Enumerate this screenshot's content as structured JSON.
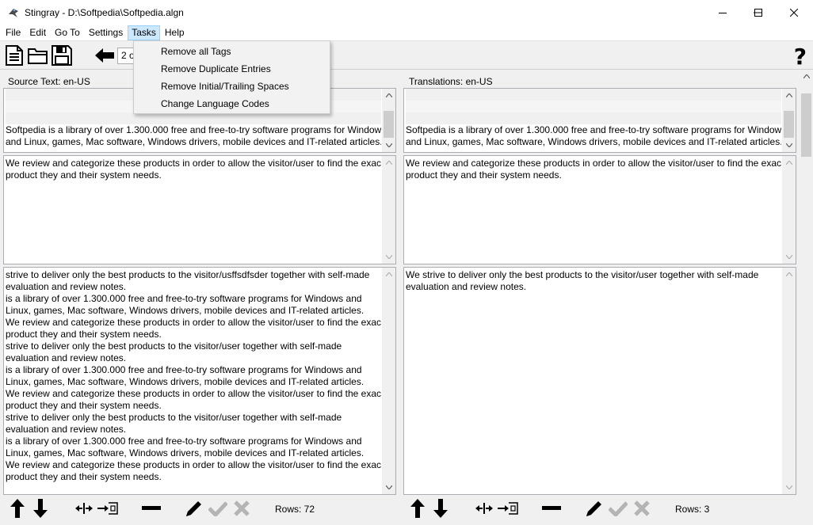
{
  "window": {
    "title": "Stingray - D:\\Softpedia\\Softpedia.algn"
  },
  "menu": {
    "items": [
      "File",
      "Edit",
      "Go To",
      "Settings",
      "Tasks",
      "Help"
    ],
    "active": "Tasks"
  },
  "tasks_menu": {
    "items": [
      "Remove all Tags",
      "Remove Duplicate Entries",
      "Remove Initial/Trailing Spaces",
      "Change Language Codes"
    ]
  },
  "toolbar": {
    "position_value": "2 o",
    "help_label": "?"
  },
  "source": {
    "header": "Source Text: en-US",
    "previous_lines": [
      "",
      "",
      "",
      "Softpedia is a library of over 1.300.000 free and free-to-try software programs for Windows",
      "and Linux, games, Mac software, Windows drivers, mobile devices and IT-related articles."
    ],
    "current_lines": [
      "We review and categorize these products in order to allow the visitor/user to find the exact",
      "product they and their system needs."
    ],
    "next_lines": [
      "strive to deliver only the best products to the visitor/usffsdfsder together with self-made",
      "evaluation and review notes.",
      "is a library of over 1.300.000 free and free-to-try software programs for Windows and",
      "Linux, games, Mac software, Windows drivers, mobile devices and IT-related articles.",
      "We review and categorize these products in order to allow the visitor/user to find the exact",
      "product they and their system needs.",
      "strive to deliver only the best products to the visitor/user together with self-made",
      "evaluation and review notes.",
      "is a library of over 1.300.000 free and free-to-try software programs for Windows and",
      "Linux, games, Mac software, Windows drivers, mobile devices and IT-related articles.",
      "We review and categorize these products in order to allow the visitor/user to find the exact",
      "product they and their system needs.",
      "strive to deliver only the best products to the visitor/user together with self-made",
      "evaluation and review notes.",
      "is a library of over 1.300.000 free and free-to-try software programs for Windows and",
      "Linux, games, Mac software, Windows drivers, mobile devices and IT-related articles.",
      "We review and categorize these products in order to allow the visitor/user to find the exact",
      "product they and their system needs."
    ],
    "rows_label": "Rows: 72"
  },
  "translation": {
    "header": "Translations: en-US",
    "previous_lines": [
      "",
      "",
      "",
      "Softpedia is a library of over 1.300.000 free and free-to-try software programs for Windows",
      "and Linux, games, Mac software, Windows drivers, mobile devices and IT-related articles."
    ],
    "current_lines": [
      "We review and categorize these products in order to allow the visitor/user to find the exact",
      "product they and their system needs."
    ],
    "next_lines": [
      "We strive to deliver only the best products to the visitor/user together with self-made",
      "evaluation and review notes."
    ],
    "rows_label": "Rows: 3"
  },
  "colors": {
    "menu_highlight": "#cce8ff",
    "disabled_icon": "#b4b4b4",
    "shaded_row": "#f0f0f0"
  }
}
